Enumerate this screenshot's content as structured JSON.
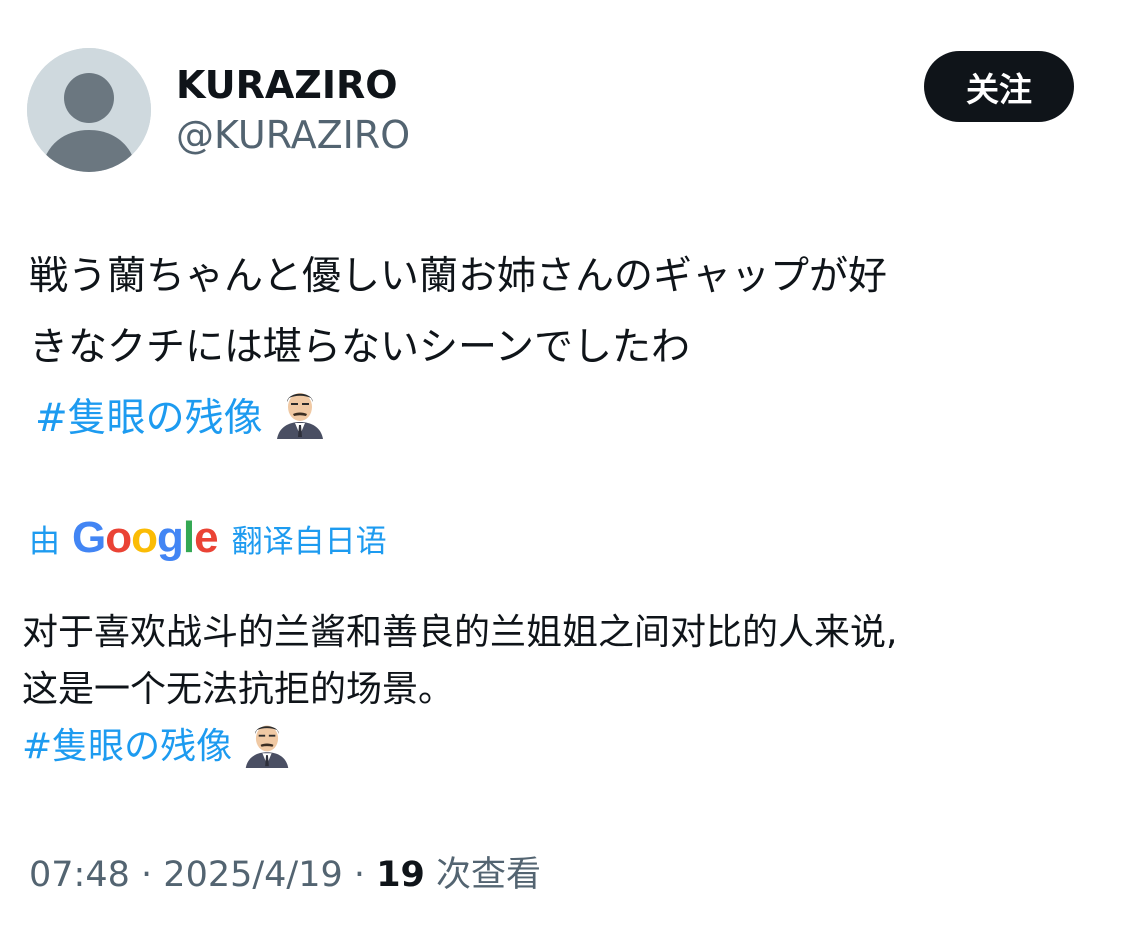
{
  "author": {
    "display_name": "KURAZIRO",
    "handle": "@KURAZIRO",
    "avatar_icon": "default-profile-avatar-icon"
  },
  "actions": {
    "follow_label": "关注"
  },
  "tweet": {
    "line1": "戦う蘭ちゃんと優しい蘭お姉さんのギャップが好",
    "line2": "きなクチには堪らないシーンでしたわ",
    "hashtag": "#隻眼の残像",
    "emoji": "detective-character-emoji-icon"
  },
  "translation": {
    "prefix": "由",
    "provider_logo": [
      "G",
      "o",
      "o",
      "g",
      "l",
      "e"
    ],
    "suffix": "翻译自日语",
    "line1": "对于喜欢战斗的兰酱和善良的兰姐姐之间对比的人来说,",
    "line2": "这是一个无法抗拒的场景。",
    "hashtag": "#隻眼の残像"
  },
  "meta": {
    "time": "07:48",
    "sep1": "·",
    "date": "2025/4/19",
    "sep2": "·",
    "views_count": "19",
    "views_label": "次查看"
  },
  "colors": {
    "link": "#1d9bf0",
    "text_primary": "#0f1419",
    "text_secondary": "#536471",
    "avatar_bg": "#cfd9de",
    "avatar_figure": "#6b7780"
  }
}
